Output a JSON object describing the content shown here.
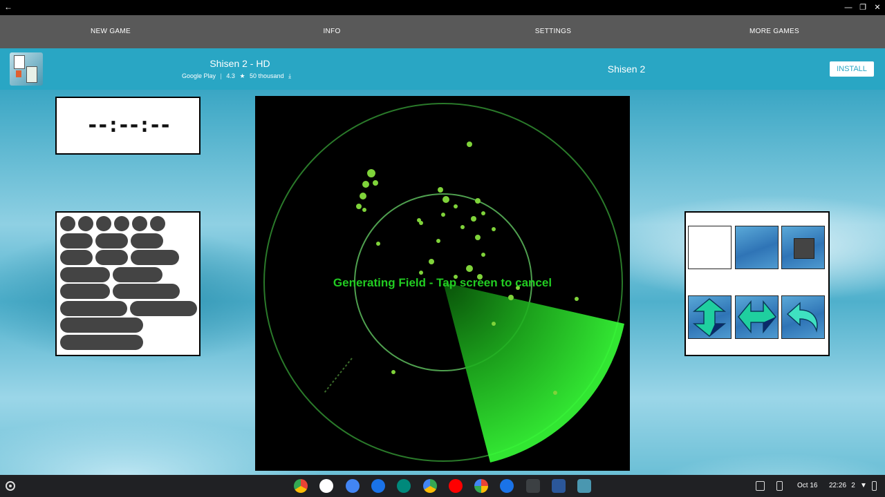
{
  "menu": {
    "new_game": "NEW GAME",
    "info": "INFO",
    "settings": "SETTINGS",
    "more_games": "MORE GAMES"
  },
  "ad": {
    "title": "Shisen 2 - HD",
    "store": "Google Play",
    "rating": "4.3",
    "downloads": "50 thousand",
    "app_name": "Shisen 2",
    "install_label": "INSTALL"
  },
  "timer": {
    "display": "--:--:--"
  },
  "radar": {
    "message": "Generating Field - Tap screen to cancel"
  },
  "tools": {
    "buttons": [
      "blank",
      "blank-blue",
      "stop",
      "vertical-arrows",
      "horizontal-arrows",
      "undo"
    ]
  },
  "colors": {
    "menu_bg": "#595959",
    "ad_bg": "#29a6c4",
    "radar_green": "#22cc22"
  },
  "shelf": {
    "apps": [
      "chrome-icon",
      "gmail-icon",
      "calendar-icon",
      "files-icon",
      "meet-icon",
      "play-store-icon",
      "youtube-icon",
      "photos-icon",
      "messages-icon",
      "terminal-icon",
      "word-icon",
      "shisen-icon"
    ],
    "date": "Oct 16",
    "time": "22:26",
    "notification_count": "2"
  }
}
